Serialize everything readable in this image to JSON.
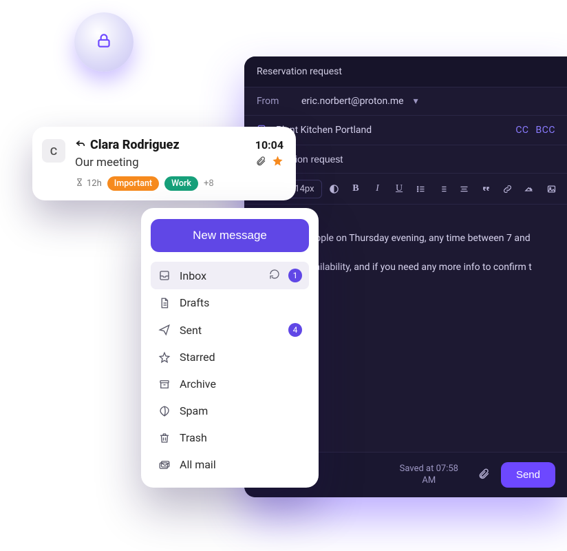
{
  "lock": {
    "icon": "lock-icon"
  },
  "compose": {
    "title": "Reservation request",
    "from_label": "From",
    "from_value": "eric.norbert@proton.me",
    "to_value": "Plant Kitchen Portland",
    "cc_label": "CC",
    "bcc_label": "BCC",
    "subject": "Reservation request",
    "font_family": "Arial",
    "font_size": "14px",
    "body_line1": "oking for 4 people on Thursday evening, any time between 7 and",
    "body_line2": "if you have availability, and if you need any more info to confirm t",
    "saved_line1": "Saved at 07:58",
    "saved_line2": "AM",
    "send_label": "Send"
  },
  "message_card": {
    "avatar_initial": "C",
    "sender": "Clara Rodriguez",
    "time": "10:04",
    "subject": "Our meeting",
    "expires_in": "12h",
    "label_important": "Important",
    "label_work": "Work",
    "plus_count": "+8"
  },
  "sidebar": {
    "new_message": "New message",
    "items": [
      {
        "label": "Inbox",
        "badge": "1",
        "selected": true,
        "refresh": true
      },
      {
        "label": "Drafts",
        "badge": "",
        "selected": false,
        "refresh": false
      },
      {
        "label": "Sent",
        "badge": "4",
        "selected": false,
        "refresh": false
      },
      {
        "label": "Starred",
        "badge": "",
        "selected": false,
        "refresh": false
      },
      {
        "label": "Archive",
        "badge": "",
        "selected": false,
        "refresh": false
      },
      {
        "label": "Spam",
        "badge": "",
        "selected": false,
        "refresh": false
      },
      {
        "label": "Trash",
        "badge": "",
        "selected": false,
        "refresh": false
      },
      {
        "label": "All mail",
        "badge": "",
        "selected": false,
        "refresh": false
      }
    ]
  }
}
